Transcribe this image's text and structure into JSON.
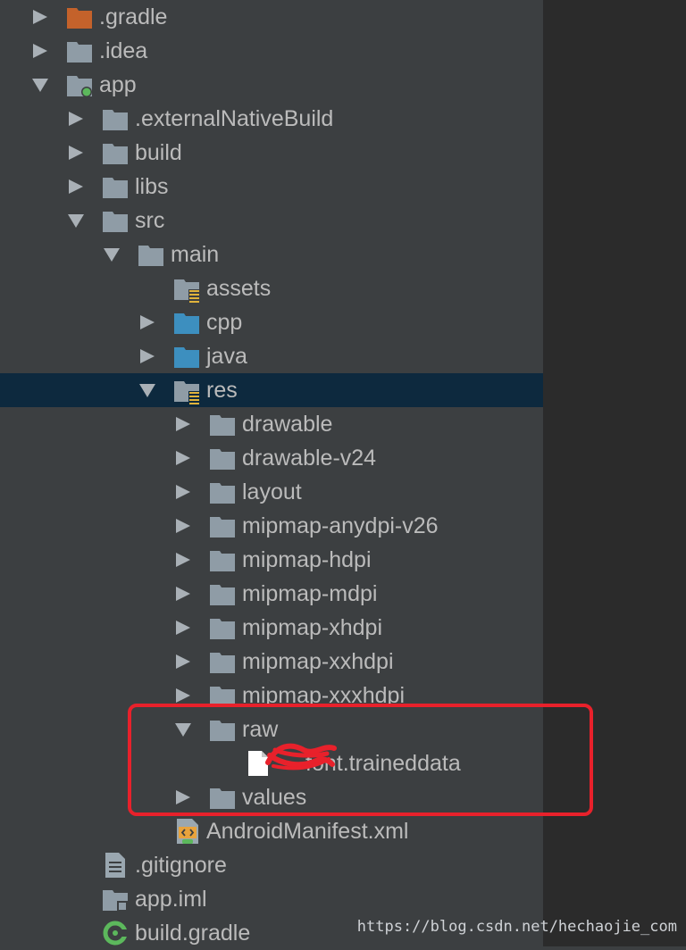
{
  "tree": [
    {
      "label": ".gradle",
      "icon": "folder-orange-icon",
      "arrow": "collapsed"
    },
    {
      "label": ".idea",
      "icon": "folder-icon",
      "arrow": "collapsed"
    },
    {
      "label": "app",
      "icon": "module-folder-icon",
      "arrow": "expanded"
    },
    {
      "label": ".externalNativeBuild",
      "icon": "folder-icon",
      "arrow": "collapsed"
    },
    {
      "label": "build",
      "icon": "folder-icon",
      "arrow": "collapsed"
    },
    {
      "label": "libs",
      "icon": "folder-icon",
      "arrow": "collapsed"
    },
    {
      "label": "src",
      "icon": "folder-icon",
      "arrow": "expanded"
    },
    {
      "label": "main",
      "icon": "folder-icon",
      "arrow": "expanded"
    },
    {
      "label": "assets",
      "icon": "resource-folder-icon",
      "arrow": "none"
    },
    {
      "label": "cpp",
      "icon": "source-folder-icon",
      "arrow": "collapsed"
    },
    {
      "label": "java",
      "icon": "source-folder-icon",
      "arrow": "collapsed"
    },
    {
      "label": "res",
      "icon": "resource-folder-icon",
      "arrow": "expanded",
      "selected": true
    },
    {
      "label": "drawable",
      "icon": "folder-icon",
      "arrow": "collapsed"
    },
    {
      "label": "drawable-v24",
      "icon": "folder-icon",
      "arrow": "collapsed"
    },
    {
      "label": "layout",
      "icon": "folder-icon",
      "arrow": "collapsed"
    },
    {
      "label": "mipmap-anydpi-v26",
      "icon": "folder-icon",
      "arrow": "collapsed"
    },
    {
      "label": "mipmap-hdpi",
      "icon": "folder-icon",
      "arrow": "collapsed"
    },
    {
      "label": "mipmap-mdpi",
      "icon": "folder-icon",
      "arrow": "collapsed"
    },
    {
      "label": "mipmap-xhdpi",
      "icon": "folder-icon",
      "arrow": "collapsed"
    },
    {
      "label": "mipmap-xxhdpi",
      "icon": "folder-icon",
      "arrow": "collapsed"
    },
    {
      "label": "mipmap-xxxhdpi",
      "icon": "folder-icon",
      "arrow": "collapsed"
    },
    {
      "label": "raw",
      "icon": "folder-icon",
      "arrow": "expanded"
    },
    {
      "label": "font.traineddata",
      "icon": "file-icon",
      "arrow": "none"
    },
    {
      "label": "values",
      "icon": "folder-icon",
      "arrow": "collapsed"
    },
    {
      "label": "AndroidManifest.xml",
      "icon": "manifest-file-icon",
      "arrow": "none"
    },
    {
      "label": ".gitignore",
      "icon": "text-file-icon",
      "arrow": "none"
    },
    {
      "label": "app.iml",
      "icon": "iml-file-icon",
      "arrow": "none"
    },
    {
      "label": "build.gradle",
      "icon": "gradle-file-icon",
      "arrow": "none"
    }
  ],
  "watermark": "https://blog.csdn.net/hechaojie_com",
  "colors": {
    "panel_bg": "#3c3f41",
    "side_bg": "#2b2b2b",
    "selection": "#0d293e",
    "text": "#bbbbbb",
    "folder": "#8f9ca6",
    "source_folder": "#3d8fbf",
    "gradle_folder": "#c4622b",
    "annotation_red": "#e8212b"
  }
}
